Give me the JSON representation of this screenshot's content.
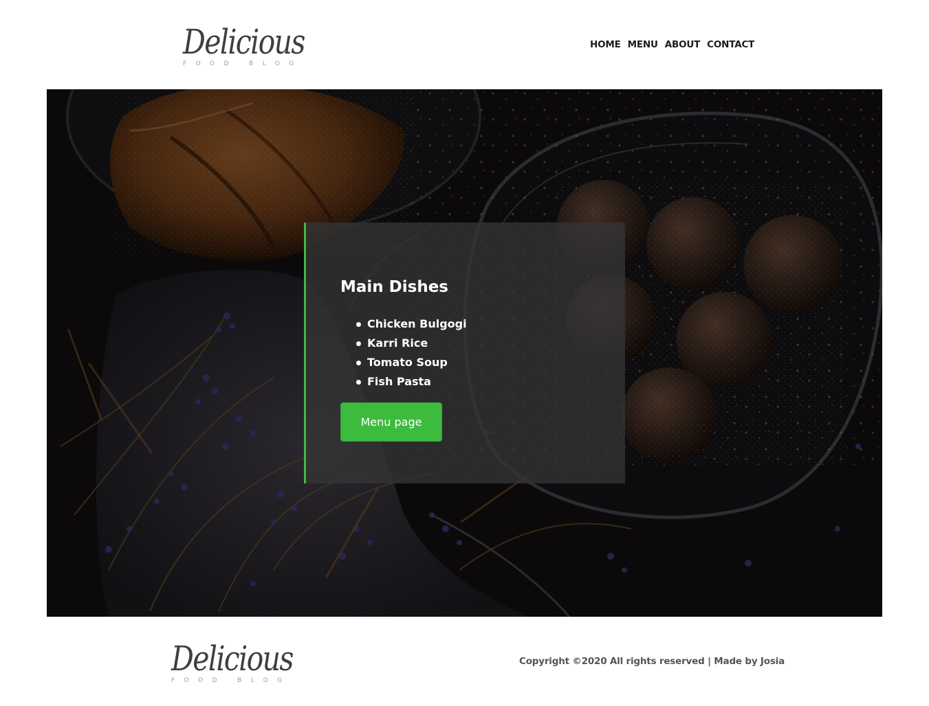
{
  "header": {
    "logo": {
      "word": "Delicious",
      "tagline": "FOOD BLOG"
    },
    "nav": [
      {
        "label": "HOME"
      },
      {
        "label": "MENU"
      },
      {
        "label": "ABOUT"
      },
      {
        "label": "CONTACT"
      }
    ]
  },
  "hero": {
    "title": "Main Dishes",
    "dishes": [
      "Chicken Bulgogi",
      "Karri Rice",
      "Tomato Soup",
      "Fish Pasta"
    ],
    "button_label": "Menu page",
    "accent_color": "#3dbb3f"
  },
  "footer": {
    "logo": {
      "word": "Delicious",
      "tagline": "FOOD BLOG"
    },
    "copyright": "Copyright ©2020 All rights reserved | Made by Josia"
  }
}
